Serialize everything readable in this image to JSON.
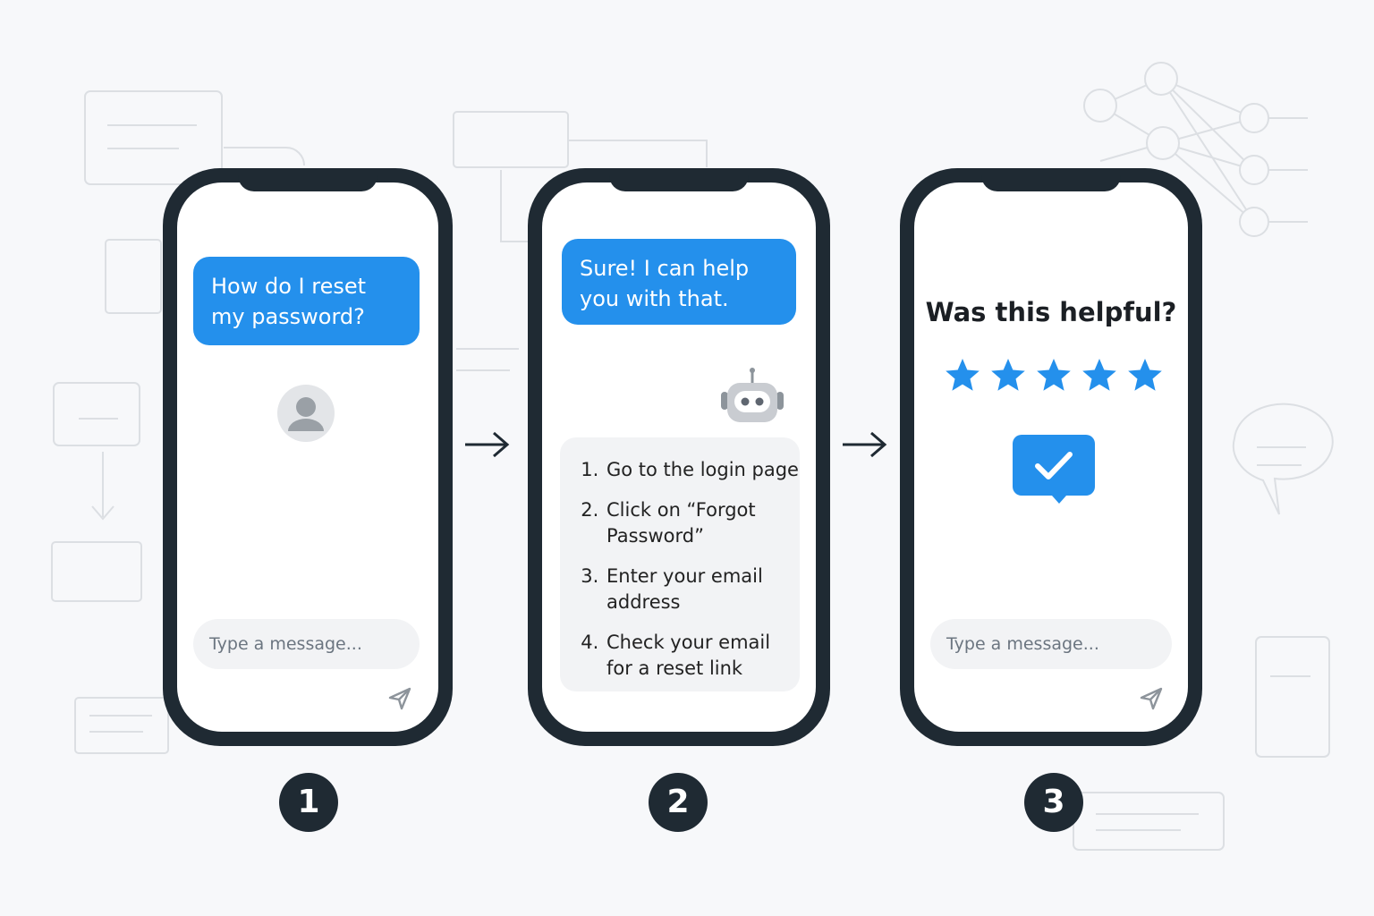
{
  "colors": {
    "accent": "#2490ec",
    "phone_frame": "#1f2a33",
    "input_bg": "#f2f3f5",
    "background": "#f7f8fa"
  },
  "screen1": {
    "user_message": [
      "How do I reset",
      "my password?"
    ],
    "input_placeholder": "Type a message...",
    "avatar_icon": "user-avatar-icon",
    "send_icon": "send-icon"
  },
  "screen2": {
    "bot_message": [
      "Sure! I can help",
      "you with that."
    ],
    "bot_icon": "robot-icon",
    "instructions": [
      "Go to the login page",
      "Click on “Forgot Password”",
      "Enter your email address",
      "Check your email for a reset link"
    ]
  },
  "screen3": {
    "question": "Was this helpful?",
    "rating": 5,
    "rating_max": 5,
    "confirm_icon": "check-bubble-icon",
    "input_placeholder": "Type a message...",
    "send_icon": "send-icon"
  },
  "step_numbers": [
    "1",
    "2",
    "3"
  ]
}
